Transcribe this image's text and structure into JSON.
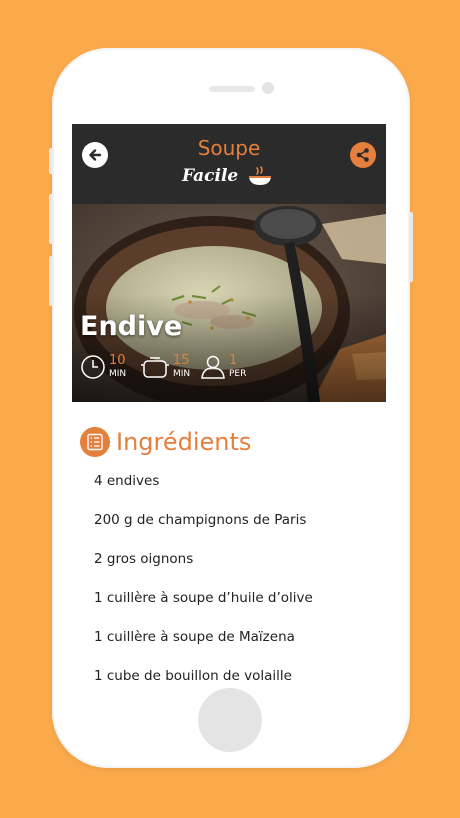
{
  "header": {
    "logo_line1": "Soupe",
    "logo_line2": "Facile",
    "back_icon": "back-arrow-icon",
    "share_icon": "share-icon"
  },
  "recipe": {
    "title": "Endive",
    "prep_time": {
      "value": "10",
      "unit": "MIN",
      "icon": "clock-icon"
    },
    "cook_time": {
      "value": "15",
      "unit": "MIN",
      "icon": "pot-icon"
    },
    "servings": {
      "value": "1",
      "unit": "PER",
      "icon": "person-icon"
    }
  },
  "ingredients": {
    "heading": "Ingrédients",
    "icon": "checklist-icon",
    "items": [
      "4 endives",
      "200 g de champignons de Paris",
      "2 gros oignons",
      "1 cuillère à soupe d’huile d’olive",
      "1 cuillère à soupe de Maïzena",
      "1 cube de bouillon de volaille"
    ]
  },
  "colors": {
    "background": "#FBAA4B",
    "accent": "#E47F3C",
    "header": "#2b2b2b"
  }
}
